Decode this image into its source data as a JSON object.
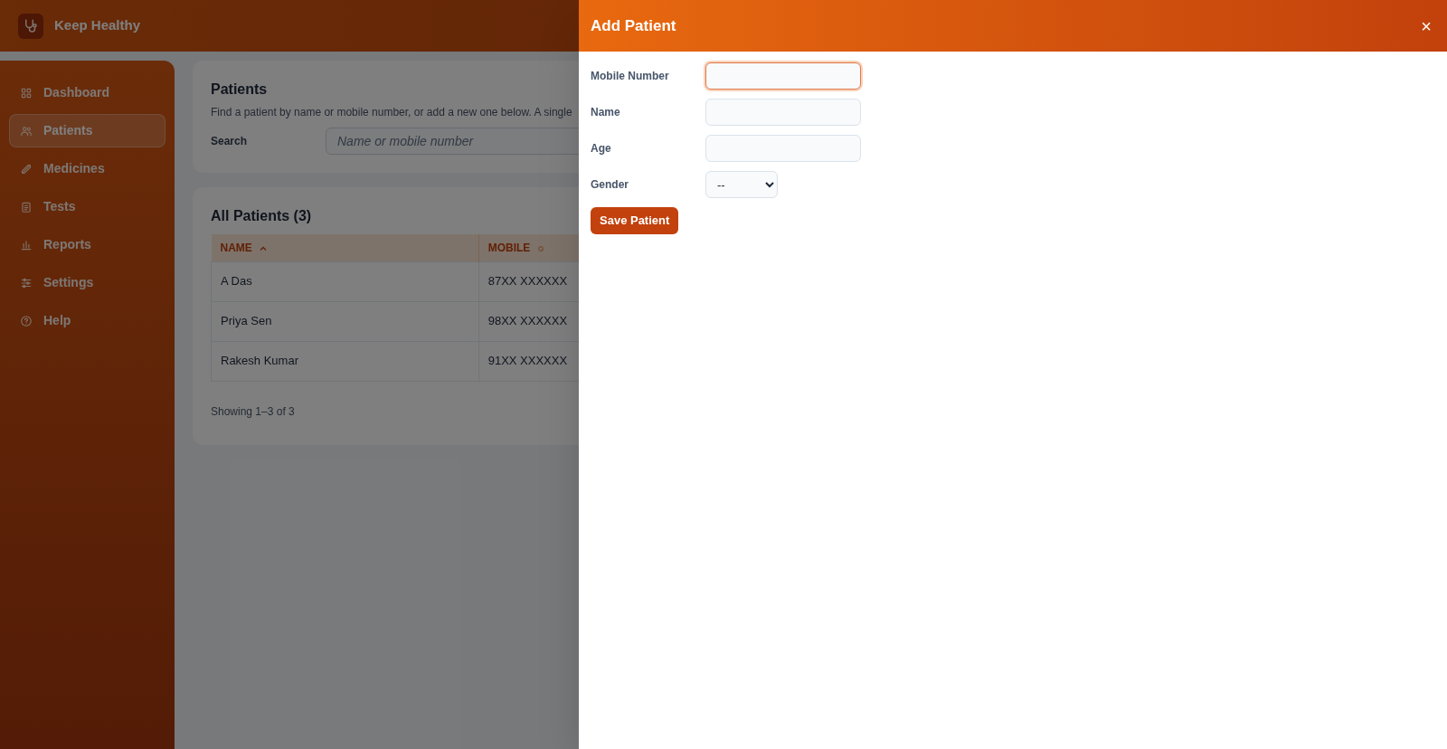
{
  "app": {
    "title": "Keep Healthy"
  },
  "sidebar": {
    "items": [
      {
        "label": "Dashboard",
        "selected": false
      },
      {
        "label": "Patients",
        "selected": true
      },
      {
        "label": "Medicines",
        "selected": false
      },
      {
        "label": "Tests",
        "selected": false
      },
      {
        "label": "Reports",
        "selected": false
      },
      {
        "label": "Settings",
        "selected": false
      },
      {
        "label": "Help",
        "selected": false
      }
    ]
  },
  "search_card": {
    "title": "Patients",
    "description": "Find a patient by name or mobile number, or add a new one below. A single",
    "search_label": "Search",
    "search_placeholder": "Name or mobile number"
  },
  "table": {
    "title": "All Patients (3)",
    "columns": [
      {
        "label": "NAME",
        "sorted": true
      },
      {
        "label": "MOBILE",
        "sorted": false
      }
    ],
    "rows": [
      [
        "A Das",
        "87XX XXXXXX"
      ],
      [
        "Priya Sen",
        "98XX XXXXXX"
      ],
      [
        "Rakesh Kumar",
        "91XX XXXXXX"
      ]
    ],
    "footer": "Showing 1–3 of 3"
  },
  "drawer": {
    "title": "Add Patient",
    "close": "×",
    "fields": [
      {
        "label": "Mobile Number",
        "kind": "text",
        "focused": true
      },
      {
        "label": "Name",
        "kind": "text",
        "focused": false
      },
      {
        "label": "Age",
        "kind": "text",
        "focused": false
      },
      {
        "label": "Gender",
        "kind": "select",
        "value": "--",
        "focused": false
      }
    ],
    "save_button": "Save Patient"
  }
}
